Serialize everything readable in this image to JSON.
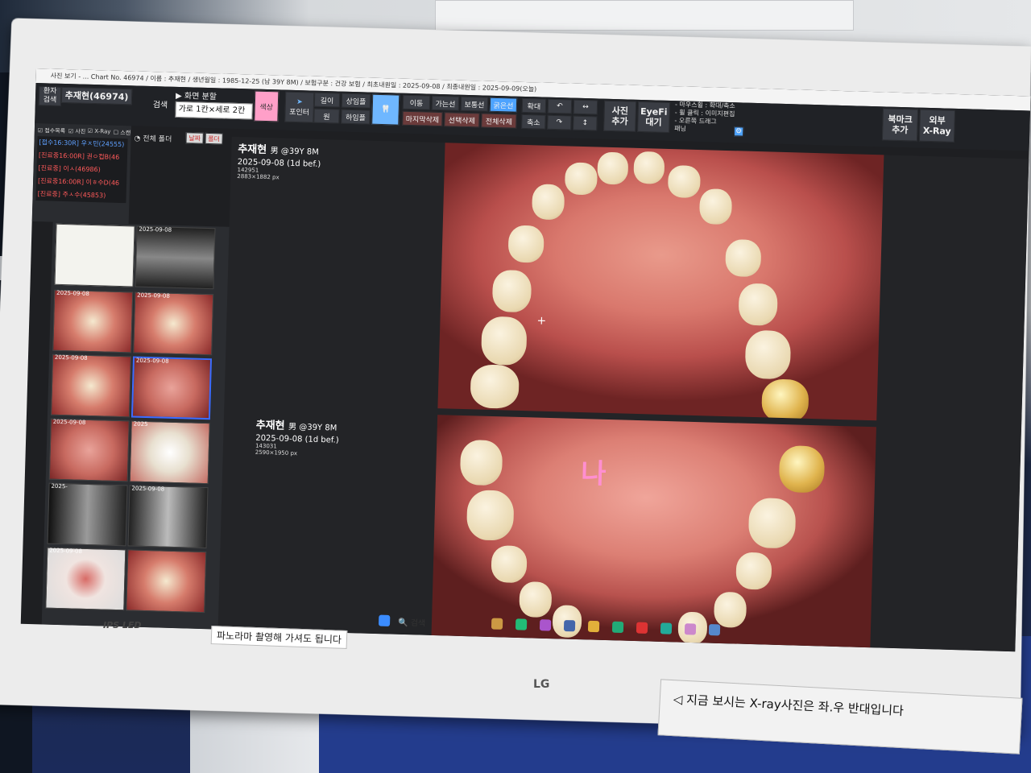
{
  "window": {
    "title": "사진 보기 - ... Chart No. 46974 / 이름 : 추재현 / 생년월일 : 1985-12-25 (남 39Y 8M) / 보험구분 : 건강 보험 / 최초내원일 : 2025-09-08 / 최종내원일 : 2025-09-09(오늘)"
  },
  "toolbar": {
    "patient_search": "환자 검색",
    "patient_name": "추재현(46974)",
    "search": "검색",
    "screen_split_label": "▶ 화면 분할",
    "split_value": "가로 1칸×세로 2칸",
    "color_button": "색상",
    "pointer": "포인터",
    "length": "길이",
    "circle": "원",
    "upper_img": "상임플",
    "lower_img": "하임플",
    "move": "이동",
    "thin_line": "가는선",
    "normal_line": "보통선",
    "thick_line": "굵은선",
    "delete_last": "마지막삭제",
    "delete_selected": "선택삭제",
    "delete_all": "전체삭제",
    "zoom_in": "확대",
    "zoom_out": "축소",
    "add_photo": "사진\n추가",
    "eyefi": "EyeFi\n대기",
    "hints": [
      "- 마우스휠 : 확대/축소",
      "- 휠 클릭 : 이미지편집",
      "- 오른쪽 드래그",
      "  패닝"
    ],
    "bookmark": "북마크\n추가",
    "external_xray": "외부\nX-Ray"
  },
  "sidebar": {
    "checkboxes": [
      "접수목록",
      "사진",
      "X-Ray",
      "스캔"
    ],
    "all_folder": "전체 폴더",
    "date_btn": "날짜",
    "folder_btn": "폴더",
    "patients": [
      {
        "text": "[접수16:30R] 우ㅈ민(24555)",
        "color": "blue"
      },
      {
        "text": "[진료중16:00R] 권ㅇ컵B(46",
        "color": "red"
      },
      {
        "text": "[진료중] 이ㅅ(46986)",
        "color": "red"
      },
      {
        "text": "[진료중16:00R] 이ㅎ수D(46",
        "color": "red"
      },
      {
        "text": "[진료중] 주ㅅ수(45853)",
        "color": "red"
      }
    ]
  },
  "thumbnails": [
    {
      "date": "",
      "kind": "doc"
    },
    {
      "date": "2025-09-08",
      "kind": "xray"
    },
    {
      "date": "2025-09-08",
      "kind": "photo"
    },
    {
      "date": "2025-09-08",
      "kind": "photo"
    },
    {
      "date": "2025-09-08",
      "kind": "photo"
    },
    {
      "date": "2025-09-08",
      "kind": "photo"
    },
    {
      "date": "2025-09-08",
      "kind": "photo"
    },
    {
      "date": "2025",
      "kind": "photo"
    },
    {
      "date": "2025-",
      "kind": "xray"
    },
    {
      "date": "2025-09-08",
      "kind": "xray"
    },
    {
      "date": "2025-09-08",
      "kind": "photo"
    },
    {
      "date": "",
      "kind": "photo"
    }
  ],
  "viewer": {
    "panel1": {
      "name": "추재현",
      "sex_age": "男 @39Y 8M",
      "date": "2025-09-08 (1d bef.)",
      "time": "142951",
      "size": "2883×1882 px"
    },
    "panel2": {
      "name": "추재현",
      "sex_age": "男 @39Y 8M",
      "date": "2025-09-08 (1d bef.)",
      "time": "143031",
      "size": "2590×1950 px"
    },
    "marker_text": "나"
  },
  "monitor": {
    "ips_led": "IPS LED",
    "brand": "LG",
    "sticker": "파노라마 촬영해 가셔도 됩니다",
    "search": "검색",
    "notice": "지금 보시는 X-ray사진은 좌.우 반대입니다"
  }
}
